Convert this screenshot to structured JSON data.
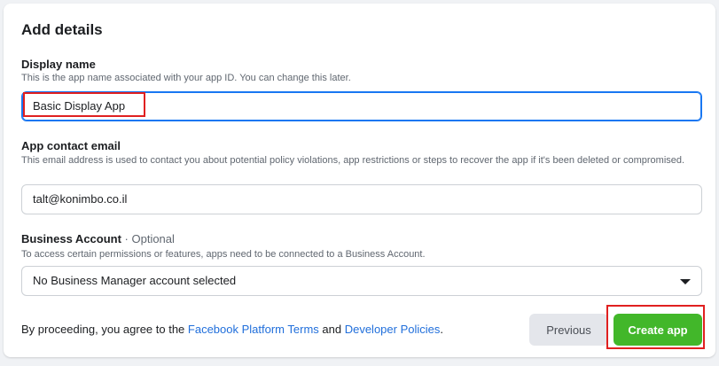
{
  "form": {
    "title": "Add details",
    "display_name": {
      "label": "Display name",
      "help": "This is the app name associated with your app ID. You can change this later.",
      "value": "Basic Display App"
    },
    "contact_email": {
      "label": "App contact email",
      "help": "This email address is used to contact you about potential policy violations, app restrictions or steps to recover the app if it's been deleted or compromised.",
      "value": "talt@konimbo.co.il"
    },
    "business_account": {
      "label": "Business Account",
      "optional": " · Optional",
      "help": "To access certain permissions or features, apps need to be connected to a Business Account.",
      "selected": "No Business Manager account selected"
    }
  },
  "footer": {
    "prefix": "By proceeding, you agree to the ",
    "link1": "Facebook Platform Terms",
    "middle": " and ",
    "link2": "Developer Policies",
    "suffix": ".",
    "previous_label": "Previous",
    "create_label": "Create app"
  },
  "colors": {
    "accent": "#1877f2",
    "link": "#216fdb",
    "create_button": "#42b72a",
    "highlight": "#e02020"
  }
}
